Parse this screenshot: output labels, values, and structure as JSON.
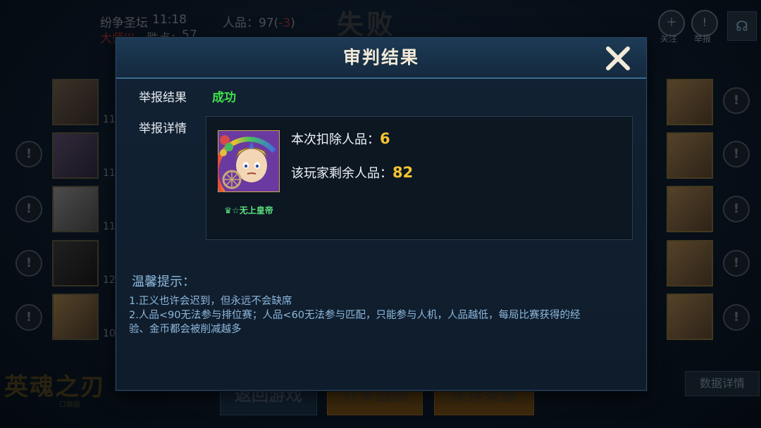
{
  "background": {
    "server": "纷争圣坛",
    "time": "11:18",
    "rank": "大师III",
    "wins_label": "胜点：",
    "wins_value": "57",
    "rp_label": "人品：",
    "rp_value": "97(",
    "rp_delta": "-3",
    "rp_close": ")",
    "result_title": "失败",
    "follow_label": "关注",
    "report_label": "举报",
    "buttons": [
      "返回游戏",
      "分享战绩",
      "保存录像"
    ],
    "stats_button": "数据详情",
    "logo": "英魂之刃",
    "logo_sub": "口袋版",
    "left_numbers": [
      "11",
      "11",
      "11",
      "12",
      "10"
    ]
  },
  "modal": {
    "title": "审判结果",
    "result_label": "举报结果",
    "result_value": "成功",
    "details_label": "举报详情",
    "hero_name": "♛☆无上皇帝",
    "deduct_label": "本次扣除人品：",
    "deduct_value": "6",
    "remaining_label": "该玩家剩余人品：",
    "remaining_value": "82",
    "tips_title": "温馨提示：",
    "tips": [
      "1.正义也许会迟到，但永远不会缺席",
      "2.人品<90无法参与排位赛；人品<60无法参与匹配，只能参与人机，人品越低，每局比赛获得的经",
      "验、金币都会被削减越多"
    ]
  },
  "colors": {
    "success": "#3fe04a",
    "value_gold": "#f5c431",
    "tips_blue": "#8db9de",
    "header_border": "#3a6b93"
  },
  "icons": [
    "close-icon",
    "warning-icon",
    "headset-icon",
    "add-friend-icon",
    "report-icon"
  ]
}
